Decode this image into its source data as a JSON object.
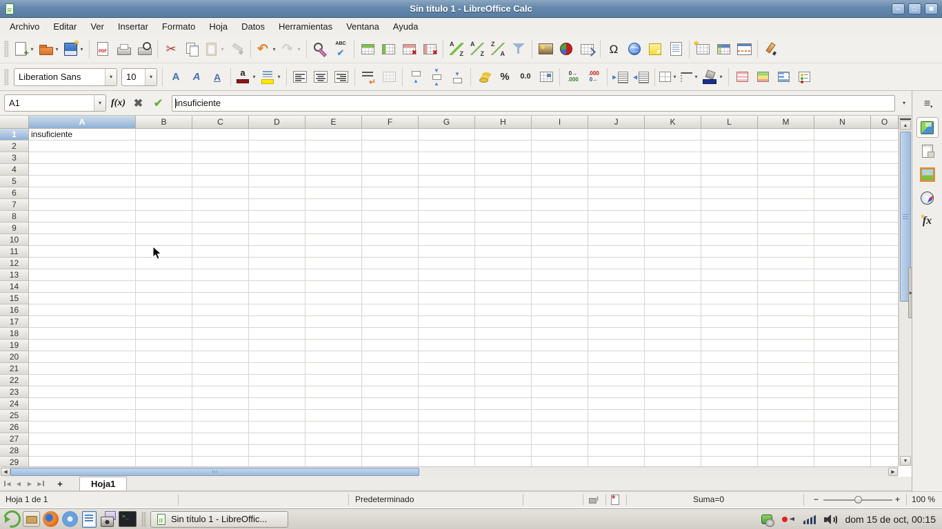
{
  "window": {
    "title": "Sin título 1 - LibreOffice Calc",
    "controls": [
      {
        "name": "minimize",
        "glyph": "─"
      },
      {
        "name": "maximize",
        "glyph": "□"
      },
      {
        "name": "close",
        "glyph": "✖"
      }
    ]
  },
  "menubar": {
    "items": [
      "Archivo",
      "Editar",
      "Ver",
      "Insertar",
      "Formato",
      "Hoja",
      "Datos",
      "Herramientas",
      "Ventana",
      "Ayuda"
    ]
  },
  "toolbars": {
    "standard": {
      "items": [
        {
          "name": "new-document",
          "kind": "css",
          "cls": "ic-newdoc",
          "dd": true
        },
        {
          "name": "open",
          "kind": "css",
          "cls": "ic-folder",
          "dd": true
        },
        {
          "name": "save",
          "kind": "css",
          "cls": "ic-floppy",
          "dd": true
        },
        {
          "kind": "sep"
        },
        {
          "name": "export-pdf",
          "kind": "css",
          "cls": "ic-pdf"
        },
        {
          "name": "print",
          "kind": "css",
          "cls": "ic-printer"
        },
        {
          "name": "print-preview",
          "kind": "css",
          "cls": "ic-preview"
        },
        {
          "kind": "sep"
        },
        {
          "name": "cut",
          "kind": "glyph",
          "glyph": "✂",
          "cls": "g-cut"
        },
        {
          "name": "copy",
          "kind": "css",
          "cls": "ic-copy"
        },
        {
          "name": "paste",
          "kind": "css",
          "cls": "ic-paste",
          "dd": true,
          "off": true
        },
        {
          "name": "clone-formatting",
          "kind": "css",
          "cls": "ic-clone",
          "off": true
        },
        {
          "kind": "sep"
        },
        {
          "name": "undo",
          "kind": "glyph",
          "glyph": "↶",
          "cls": "g-undo",
          "dd": true
        },
        {
          "name": "redo",
          "kind": "glyph",
          "glyph": "↷",
          "cls": "g-redo",
          "dd": true,
          "off": true
        },
        {
          "kind": "sep"
        },
        {
          "name": "find-and-replace",
          "kind": "css",
          "cls": "ic-find"
        },
        {
          "name": "spelling",
          "kind": "css",
          "cls": "ic-spell"
        },
        {
          "kind": "sep"
        },
        {
          "name": "insert-row-above",
          "kind": "css",
          "cls": "ic-grid ic-rowins"
        },
        {
          "name": "insert-column-before",
          "kind": "css",
          "cls": "ic-grid ic-colins"
        },
        {
          "name": "delete-row",
          "kind": "css",
          "cls": "ic-grid ic-rowdel"
        },
        {
          "name": "delete-column",
          "kind": "css",
          "cls": "ic-grid ic-coldel"
        },
        {
          "kind": "sep"
        },
        {
          "name": "sort",
          "kind": "css",
          "cls": "ic-sort"
        },
        {
          "name": "sort-ascending",
          "kind": "css",
          "cls": "ic-sortaz"
        },
        {
          "name": "sort-descending",
          "kind": "css",
          "cls": "ic-sortza"
        },
        {
          "name": "autofilter",
          "kind": "css",
          "cls": "ic-funnel"
        },
        {
          "kind": "sep"
        },
        {
          "name": "insert-image",
          "kind": "css",
          "cls": "ic-image"
        },
        {
          "name": "insert-chart",
          "kind": "css",
          "cls": "ic-pie"
        },
        {
          "name": "pivot-table",
          "kind": "css",
          "cls": "ic-grid ic-pivot"
        },
        {
          "kind": "sep"
        },
        {
          "name": "special-character",
          "kind": "glyph",
          "glyph": "Ω",
          "cls": "g-omega"
        },
        {
          "name": "hyperlink",
          "kind": "css",
          "cls": "ic-globe"
        },
        {
          "name": "insert-comment",
          "kind": "css",
          "cls": "ic-note"
        },
        {
          "name": "headers-and-footers",
          "kind": "css",
          "cls": "ic-hf"
        },
        {
          "kind": "sep"
        },
        {
          "name": "define-print-area",
          "kind": "css",
          "cls": "ic-grid ic-printarea"
        },
        {
          "name": "freeze-rows-columns",
          "kind": "css",
          "cls": "ic-grid ic-freeze"
        },
        {
          "name": "split-window",
          "kind": "css",
          "cls": "ic-split"
        },
        {
          "kind": "sep"
        },
        {
          "name": "show-draw-functions",
          "kind": "css",
          "cls": "ic-draw"
        }
      ]
    },
    "formatting": {
      "items": [
        {
          "name": "font-name",
          "kind": "combo",
          "value": "Liberation Sans",
          "w": 150
        },
        {
          "name": "font-size",
          "kind": "combo",
          "value": "10",
          "w": 52
        },
        {
          "kind": "sep"
        },
        {
          "name": "bold",
          "kind": "glyph",
          "glyph": "A",
          "cls": "g-bold"
        },
        {
          "name": "italic",
          "kind": "glyph",
          "glyph": "A",
          "cls": "g-italic"
        },
        {
          "name": "underline",
          "kind": "glyph",
          "glyph": "A",
          "cls": "g-under"
        },
        {
          "kind": "sep"
        },
        {
          "name": "font-color",
          "kind": "css",
          "cls": "ic-fontcolor",
          "dd": true
        },
        {
          "name": "highlighting-color",
          "kind": "css",
          "cls": "ic-highlight",
          "dd": true
        },
        {
          "kind": "sep"
        },
        {
          "name": "align-left",
          "kind": "css",
          "cls": "ic-alignl"
        },
        {
          "name": "align-center",
          "kind": "css",
          "cls": "ic-alignc"
        },
        {
          "name": "align-right",
          "kind": "css",
          "cls": "ic-alignr"
        },
        {
          "kind": "sep"
        },
        {
          "name": "wrap-text",
          "kind": "css",
          "cls": "ic-wrap"
        },
        {
          "name": "merge-cells",
          "kind": "css",
          "cls": "ic-grid",
          "off": true
        },
        {
          "kind": "sep"
        },
        {
          "name": "align-top",
          "kind": "css",
          "cls": "ic-vtop"
        },
        {
          "name": "center-vertically",
          "kind": "css",
          "cls": "ic-vcenter"
        },
        {
          "name": "align-bottom",
          "kind": "css",
          "cls": "ic-vbottom"
        },
        {
          "kind": "sep"
        },
        {
          "name": "currency-format",
          "kind": "css",
          "cls": "ic-coins"
        },
        {
          "name": "percent-format",
          "kind": "glyph",
          "glyph": "%",
          "cls": "g-pct"
        },
        {
          "name": "number-format",
          "kind": "glyph",
          "glyph": "0.0",
          "cls": "g-num"
        },
        {
          "name": "date-format",
          "kind": "css",
          "cls": "ic-grid ic-datefmt"
        },
        {
          "kind": "sep"
        },
        {
          "name": "add-decimal-place",
          "kind": "mini",
          "top": "0→",
          "bot": ".000",
          "cls": "mini-add"
        },
        {
          "name": "delete-decimal-place",
          "kind": "mini",
          "top": ".000",
          "bot": "0←",
          "cls": "mini-del"
        },
        {
          "kind": "sep"
        },
        {
          "name": "increase-indent",
          "kind": "css",
          "cls": "ic-indinc"
        },
        {
          "name": "decrease-indent",
          "kind": "css",
          "cls": "ic-inddec"
        },
        {
          "kind": "sep"
        },
        {
          "name": "borders",
          "kind": "css",
          "cls": "ic-borders",
          "dd": true
        },
        {
          "name": "border-style",
          "kind": "css",
          "cls": "ic-bstyle",
          "dd": true
        },
        {
          "name": "background-color",
          "kind": "css",
          "cls": "ic-bucket",
          "dd": true
        },
        {
          "kind": "sep"
        },
        {
          "name": "conditional-formatting",
          "kind": "css",
          "cls": "ic-cond1"
        },
        {
          "name": "conditional-color-scale",
          "kind": "css",
          "cls": "ic-cond2"
        },
        {
          "name": "conditional-data-bars",
          "kind": "css",
          "cls": "ic-cond3"
        },
        {
          "name": "conditional-icon-set",
          "kind": "css",
          "cls": "ic-cond4"
        }
      ]
    }
  },
  "formula_bar": {
    "cell_reference": "A1",
    "function_wizard_label": "f(x)",
    "cancel_glyph": "✖",
    "accept_glyph": "✔",
    "input_value": "insuficiente",
    "expand_glyph": "▾"
  },
  "grid": {
    "columns": [
      "A",
      "B",
      "C",
      "D",
      "E",
      "F",
      "G",
      "H",
      "I",
      "J",
      "K",
      "L",
      "M",
      "N",
      "O"
    ],
    "visible_row_count": 29,
    "active_cell": "A1",
    "active_column": "A",
    "active_row": 1,
    "cells": {
      "A1": "insuficiente"
    }
  },
  "sheet_tabs": {
    "nav": [
      {
        "name": "first-sheet",
        "glyph": "◀",
        "cls": "edge first"
      },
      {
        "name": "previous-sheet",
        "glyph": "◀",
        "cls": ""
      },
      {
        "name": "next-sheet",
        "glyph": "▶",
        "cls": ""
      },
      {
        "name": "last-sheet",
        "glyph": "▶",
        "cls": "edge last"
      }
    ],
    "add_sheet_glyph": "+",
    "tabs": [
      {
        "label": "Hoja1",
        "active": true
      }
    ]
  },
  "status_bar": {
    "sheet_info": "Hoja 1 de 1",
    "page_style": "Predeterminado",
    "selection_sum": "Suma=0",
    "zoom_out_glyph": "−",
    "zoom_in_glyph": "+",
    "zoom_level": "100 %"
  },
  "sidebar": {
    "items": [
      {
        "name": "sidebar-settings",
        "cls": "ic-sbsettings",
        "active": false
      },
      {
        "name": "sidebar-properties",
        "cls": "ic-cube",
        "active": true
      },
      {
        "name": "sidebar-styles",
        "cls": "ic-styles",
        "active": false
      },
      {
        "name": "sidebar-gallery",
        "cls": "ic-gallery",
        "active": false
      },
      {
        "name": "sidebar-navigator",
        "cls": "ic-compass",
        "active": false
      },
      {
        "name": "sidebar-functions",
        "cls": "ic-fx",
        "active": false
      }
    ]
  },
  "taskbar": {
    "launchers": [
      "app-launcher",
      "file-manager",
      "firefox",
      "chromium",
      "libreoffice-writer",
      "screenshot-tool",
      "terminal"
    ],
    "window_button_label": "Sin título 1 - LibreOffic...",
    "clock": "dom 15 de oct, 00:15"
  }
}
